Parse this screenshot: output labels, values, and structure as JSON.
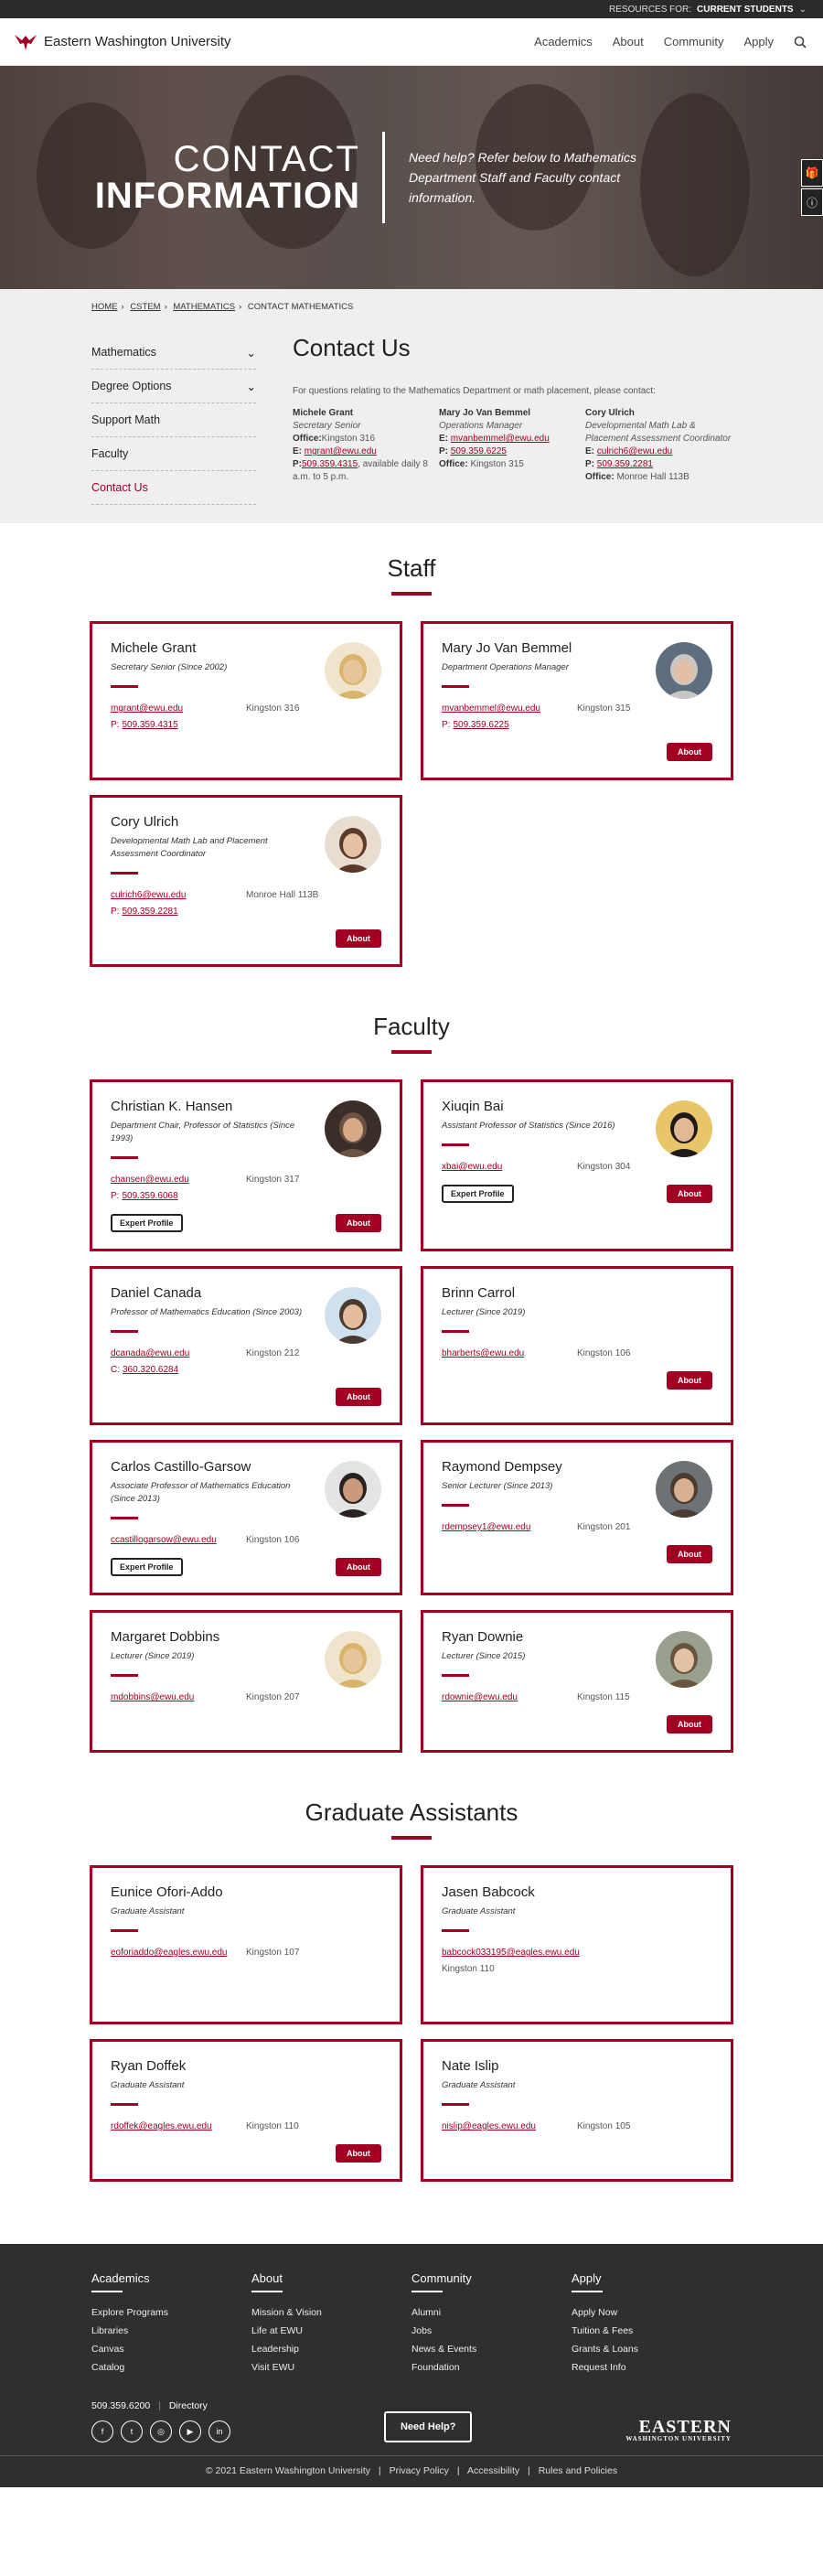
{
  "topbar": {
    "resources_label": "RESOURCES FOR:",
    "resources_value": "CURRENT STUDENTS"
  },
  "header": {
    "logo_text": "Eastern Washington University",
    "nav": [
      "Academics",
      "About",
      "Community",
      "Apply"
    ]
  },
  "hero": {
    "title_top": "CONTACT",
    "title_bottom": "INFORMATION",
    "subtitle": "Need help? Refer below to Mathematics Department Staff and Faculty contact information."
  },
  "breadcrumb": [
    "HOME",
    "CSTEM",
    "MATHEMATICS",
    "CONTACT MATHEMATICS"
  ],
  "sidebar": [
    {
      "label": "Mathematics",
      "expand": true
    },
    {
      "label": "Degree Options",
      "expand": true
    },
    {
      "label": "Support Math",
      "expand": false
    },
    {
      "label": "Faculty",
      "expand": false
    },
    {
      "label": "Contact Us",
      "expand": false,
      "active": true
    }
  ],
  "contact": {
    "heading": "Contact Us",
    "intro": "For questions relating to the Mathematics Department or math placement, please contact:",
    "people": [
      {
        "name": "Michele Grant",
        "title": "Secretary Senior",
        "office_label": "Office:",
        "office": "Kingston 316",
        "email_label": "E:",
        "email": "mgrant@ewu.edu",
        "phone_label": "P:",
        "phone": "509.359.4315",
        "note": ", available daily 8 a.m. to 5 p.m."
      },
      {
        "name": "Mary Jo Van Bemmel",
        "title": "Operations Manager",
        "email_label": "E:",
        "email": "mvanbemmel@ewu.edu",
        "phone_label": "P:",
        "phone": "509.359.6225",
        "office_label": "Office:",
        "office": "Kingston 315"
      },
      {
        "name": "Cory Ulrich",
        "title": "Developmental Math Lab & Placement Assessment Coordinator",
        "email_label": "E:",
        "email": "culrich6@ewu.edu",
        "phone_label": "P:",
        "phone": "509.359.2281",
        "office_label": "Office:",
        "office": "Monroe Hall 113B"
      }
    ]
  },
  "sections": {
    "staff": "Staff",
    "faculty": "Faculty",
    "grads": "Graduate Assistants"
  },
  "buttons": {
    "about": "About",
    "expert": "Expert Profile"
  },
  "staff": [
    {
      "name": "Michele Grant",
      "title": "Secretary Senior (Since 2002)",
      "email": "mgrant@ewu.edu",
      "phone_label": "P:",
      "phone": "509.359.4315",
      "office": "Kingston 316",
      "photo": "blonde",
      "about": false,
      "expert": false
    },
    {
      "name": "Mary Jo Van Bemmel",
      "title": "Department Operations Manager",
      "email": "mvanbemmel@ewu.edu",
      "phone_label": "P:",
      "phone": "509.359.6225",
      "office": "Kingston 315",
      "photo": "gray",
      "about": true,
      "expert": false
    },
    {
      "name": "Cory Ulrich",
      "title": "Developmental Math Lab and Placement Assessment Coordinator",
      "email": "culrich6@ewu.edu",
      "phone_label": "P:",
      "phone": "509.359.2281",
      "office": "Monroe Hall 113B",
      "photo": "brunette",
      "about": true,
      "expert": false
    }
  ],
  "faculty": [
    {
      "name": "Christian K. Hansen",
      "title": "Department Chair, Professor of Statistics (Since 1993)",
      "email": "chansen@ewu.edu",
      "phone_label": "P:",
      "phone": "509.359.6068",
      "office": "Kingston 317",
      "photo": "dark",
      "about": true,
      "expert": true
    },
    {
      "name": "Xiuqin Bai",
      "title": "Assistant Professor of Statistics (Since 2016)",
      "email": "xbai@ewu.edu",
      "office": "Kingston 304",
      "photo": "asian",
      "about": true,
      "expert": true
    },
    {
      "name": "Daniel Canada",
      "title": "Professor of Mathematics Education (Since 2003)",
      "email": "dcanada@ewu.edu",
      "phone_label": "C:",
      "phone": "360.320.6284",
      "office": "Kingston 212",
      "photo": "light",
      "about": true,
      "expert": false
    },
    {
      "name": "Brinn Carrol",
      "title": "Lecturer (Since 2019)",
      "email": "bharberts@ewu.edu",
      "office": "Kingston 106",
      "photo": "",
      "about": true,
      "expert": false
    },
    {
      "name": "Carlos Castillo-Garsow",
      "title": "Associate Professor of Mathematics Education (Since 2013)",
      "email": "ccastillogarsow@ewu.edu",
      "office": "Kingston 106",
      "photo": "redshirt",
      "about": true,
      "expert": true
    },
    {
      "name": "Raymond Dempsey",
      "title": "Senior Lecturer (Since 2013)",
      "email": "rdempsey1@ewu.edu",
      "office": "Kingston 201",
      "photo": "bald",
      "about": true,
      "expert": false
    },
    {
      "name": "Margaret Dobbins",
      "title": "Lecturer (Since 2019)",
      "email": "mdobbins@ewu.edu",
      "office": "Kingston 207",
      "photo": "blonde",
      "about": false,
      "expert": false
    },
    {
      "name": "Ryan Downie",
      "title": "Lecturer (Since 2015)",
      "email": "rdownie@ewu.edu",
      "office": "Kingston 115",
      "photo": "glasses",
      "about": true,
      "expert": false
    }
  ],
  "grads": [
    {
      "name": "Eunice Ofori-Addo",
      "title": "Graduate Assistant",
      "email": "eoforiaddo@eagles.ewu.edu",
      "office": "Kingston 107",
      "about": false
    },
    {
      "name": "Jasen Babcock",
      "title": "Graduate Assistant",
      "email": "babcock033195@eagles.ewu.edu",
      "office": "Kingston 110",
      "about": false,
      "stack": true
    },
    {
      "name": "Ryan Doffek",
      "title": "Graduate Assistant",
      "email": "rdoffek@eagles.ewu.edu",
      "office": "Kingston 110",
      "about": true
    },
    {
      "name": "Nate Islip",
      "title": "Graduate Assistant",
      "email": "nislip@eagles.ewu.edu",
      "office": "Kingston 105",
      "about": false
    }
  ],
  "footer": {
    "cols": [
      {
        "head": "Academics",
        "links": [
          "Explore Programs",
          "Libraries",
          "Canvas",
          "Catalog"
        ]
      },
      {
        "head": "About",
        "links": [
          "Mission & Vision",
          "Life at EWU",
          "Leadership",
          "Visit EWU"
        ]
      },
      {
        "head": "Community",
        "links": [
          "Alumni",
          "Jobs",
          "News & Events",
          "Foundation"
        ]
      },
      {
        "head": "Apply",
        "links": [
          "Apply Now",
          "Tuition & Fees",
          "Grants & Loans",
          "Request Info"
        ]
      }
    ],
    "phone": "509.359.6200",
    "directory": "Directory",
    "need_help": "Need Help?",
    "brand": "EASTERN",
    "brand_sub": "WASHINGTON UNIVERSITY",
    "copyright": "© 2021 Eastern Washington University",
    "legal": [
      "Privacy Policy",
      "Accessibility",
      "Rules and Policies"
    ]
  },
  "colors": {
    "accent": "#a10022",
    "footer": "#2f2f2f"
  }
}
